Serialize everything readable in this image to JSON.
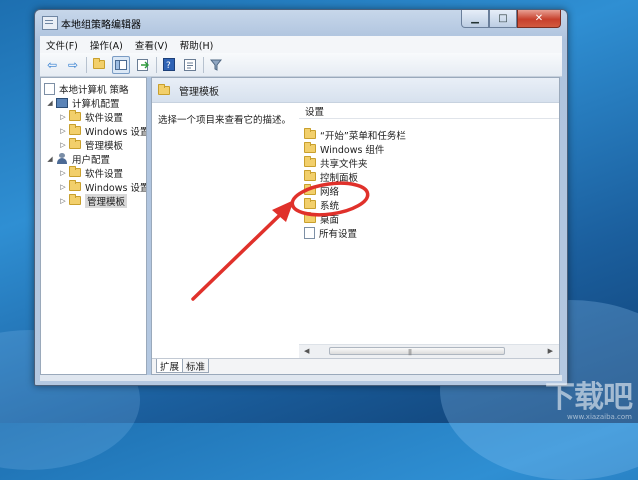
{
  "window": {
    "title": "本地组策略编辑器"
  },
  "menubar": [
    "文件(F)",
    "操作(A)",
    "查看(V)",
    "帮助(H)"
  ],
  "toolbar": [
    "back-icon",
    "forward-icon",
    "up-folder-icon",
    "show-hide-tree-icon",
    "export-list-icon",
    "help-icon",
    "properties-icon",
    "filter-icon"
  ],
  "tree": {
    "root": "本地计算机 策略",
    "computer": "计算机配置",
    "software1": "软件设置",
    "windows1": "Windows 设置",
    "admin1": "管理模板",
    "user": "用户配置",
    "software2": "软件设置",
    "windows2": "Windows 设置",
    "admin2": "管理模板"
  },
  "right": {
    "header": "管理模板",
    "description": "选择一个项目来查看它的描述。",
    "column": "设置",
    "items": [
      "“开始”菜单和任务栏",
      "Windows 组件",
      "共享文件夹",
      "控制面板",
      "网络",
      "系统",
      "桌面",
      "所有设置"
    ]
  },
  "tabs": [
    "扩展",
    "标准"
  ],
  "watermark": {
    "main": "下载吧",
    "sub": "www.xiazaiba.com"
  },
  "colors": {
    "annotation": "#e0312b",
    "desktop": "#2f8fd3",
    "selected_node": "#d8d8d8"
  }
}
